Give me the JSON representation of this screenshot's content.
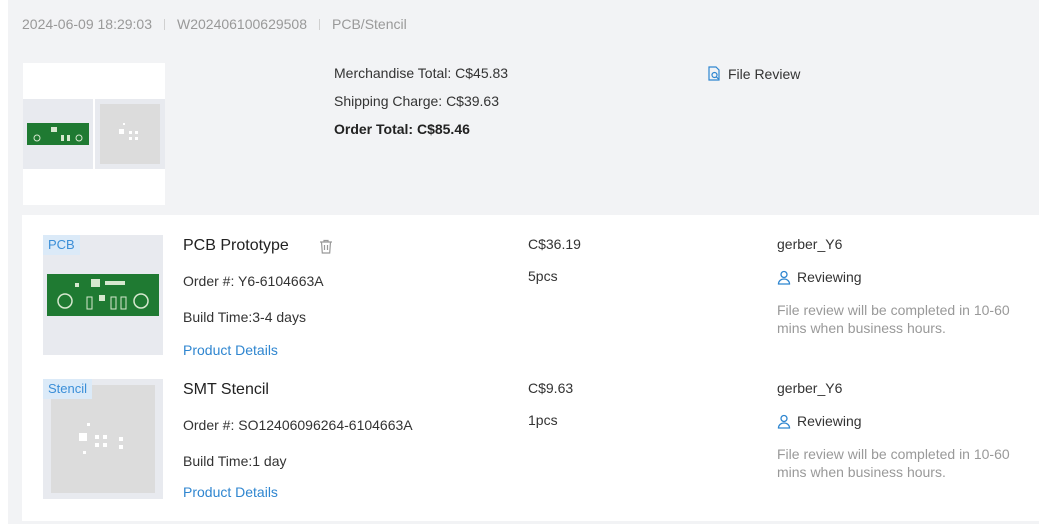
{
  "order": {
    "datetime": "2024-06-09 18:29:03",
    "order_id": "W202406100629508",
    "category": "PCB/Stencil"
  },
  "summary": {
    "merchandise_total": "Merchandise Total: C$45.83",
    "shipping_charge": "Shipping Charge: C$39.63",
    "order_total": "Order Total: C$85.46",
    "file_review_label": "File Review",
    "file_review_icon": "file-search-icon"
  },
  "items": [
    {
      "tag": "PCB",
      "name": "PCB Prototype",
      "order_no": "Order #: Y6-6104663A",
      "build_time": "Build Time:3-4 days",
      "details_link": "Product Details",
      "price": "C$36.19",
      "quantity": "5pcs",
      "file_name": "gerber_Y6",
      "status": "Reviewing",
      "note": "File review will be completed in 10-60 mins when business hours.",
      "has_delete": true
    },
    {
      "tag": "Stencil",
      "name": "SMT Stencil",
      "order_no": "Order #: SO12406096264-6104663A",
      "build_time": "Build Time:1 day",
      "details_link": "Product Details",
      "price": "C$9.63",
      "quantity": "1pcs",
      "file_name": "gerber_Y6",
      "status": "Reviewing",
      "note": "File review will be completed in 10-60 mins when business hours.",
      "has_delete": false
    }
  ],
  "colors": {
    "card_background": "#f2f3f5",
    "link_blue": "#2f86d0",
    "tag_background": "#dbeaf8",
    "pcb_green": "#1f7a32",
    "muted_text": "#999999"
  }
}
